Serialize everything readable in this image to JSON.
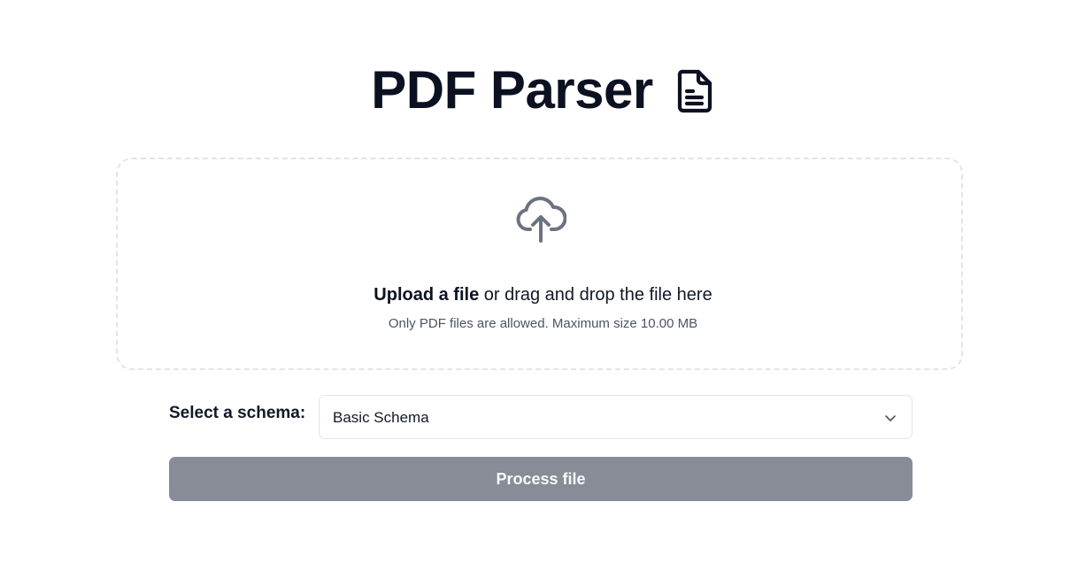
{
  "header": {
    "title": "PDF Parser",
    "icon": "document-text-icon"
  },
  "upload": {
    "icon": "cloud-upload-icon",
    "link_label": "Upload a file",
    "rest_label": " or drag and drop the file here",
    "hint": "Only PDF files are allowed. Maximum size 10.00 MB"
  },
  "schema": {
    "label": "Select a schema:",
    "selected": "Basic Schema",
    "icon": "chevron-down-icon"
  },
  "actions": {
    "process_label": "Process file",
    "process_color": "#878c96"
  }
}
